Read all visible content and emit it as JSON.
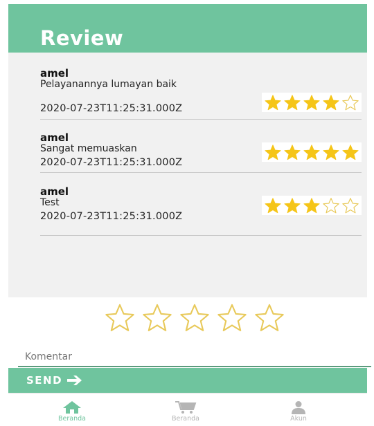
{
  "header": {
    "title": "Review"
  },
  "reviews": [
    {
      "name": "amel",
      "comment": "Pelayanannya lumayan baik",
      "date": "2020-07-23T11:25:31.000Z",
      "rating": 4
    },
    {
      "name": "amel",
      "comment": "Sangat memuaskan",
      "date": "2020-07-23T11:25:31.000Z",
      "rating": 5
    },
    {
      "name": "amel",
      "comment": "Test",
      "date": "2020-07-23T11:25:31.000Z",
      "rating": 3
    }
  ],
  "rating_input": {
    "value": 0,
    "max": 5
  },
  "comment": {
    "placeholder": "Komentar",
    "value": ""
  },
  "send": {
    "label": "SEND",
    "icon": "arrow-right-icon"
  },
  "nav": {
    "items": [
      {
        "label": "Beranda",
        "icon": "home-icon",
        "active": true
      },
      {
        "label": "Beranda",
        "icon": "cart-icon",
        "active": false
      },
      {
        "label": "Akun",
        "icon": "user-icon",
        "active": false
      }
    ]
  },
  "colors": {
    "primary": "#6fc49e",
    "star": "#f5c518",
    "star_outline": "#e8c95a",
    "nav_active": "#6fc49e",
    "nav_inactive": "#b5b5b5"
  }
}
